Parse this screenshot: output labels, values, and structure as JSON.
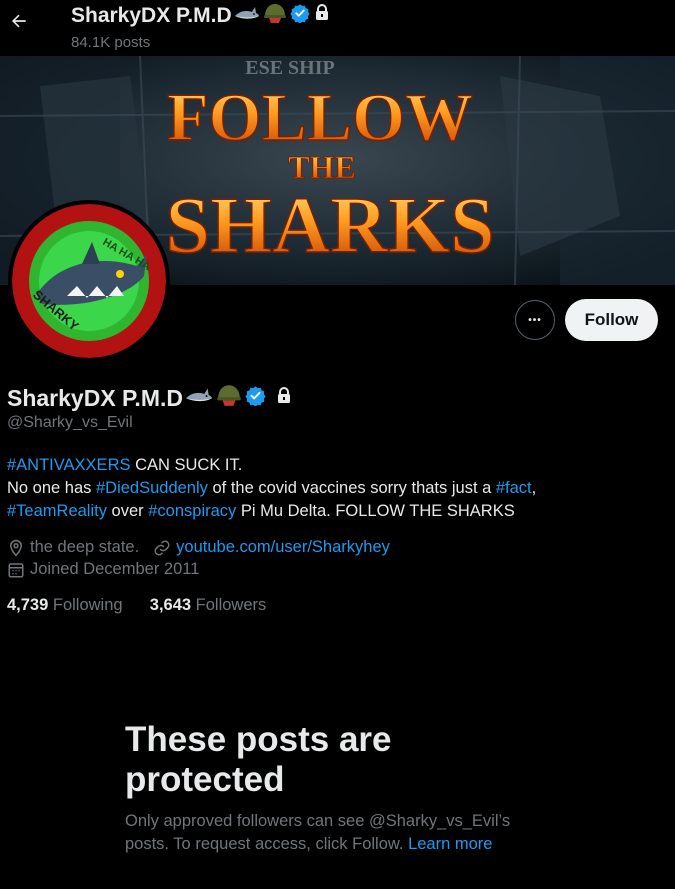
{
  "header": {
    "title": "SharkyDX P.M.D",
    "post_count": "84.1K posts"
  },
  "banner": {
    "line1": "FOLLOW",
    "line2": "THE",
    "line3": "SHARKS",
    "sign_text": "ESE SHIP"
  },
  "avatar": {
    "text_top": "HA HA HA",
    "text_bottom": "SHARKY"
  },
  "actions": {
    "more_label": "•••",
    "follow_label": "Follow"
  },
  "profile": {
    "name": "SharkyDX P.M.D",
    "handle": "@Sharky_vs_Evil",
    "bio": {
      "l1_tag": "#ANTIVAXXERS",
      "l1_text": " CAN SUCK IT.",
      "l2_a": "No one has ",
      "l2_tag": "#DiedSuddenly",
      "l2_b": " of the covid vaccines sorry thats just a ",
      "l2_tag2": "#fact",
      "l2_c": ",",
      "l3_tag": "#TeamReality",
      "l3_a": " over ",
      "l3_tag2": "#conspiracy",
      "l3_b": " Pi Mu Delta. FOLLOW THE SHARKS"
    },
    "location": "the deep state.",
    "website": "youtube.com/user/Sharkyhey",
    "joined": "Joined December 2011",
    "following_count": "4,739",
    "following_label": " Following",
    "followers_count": "3,643",
    "followers_label": " Followers"
  },
  "protected": {
    "title": "These posts are protected",
    "body": "Only approved followers can see @Sharky_vs_Evil’s posts. To request access, click Follow. ",
    "learn_more": "Learn more"
  },
  "colors": {
    "accent": "#1d9bf0",
    "secondary_text": "#71767b",
    "primary_text": "#e7e9ea",
    "background": "#000000"
  },
  "icons": [
    "back-arrow-icon",
    "shark-emoji-icon",
    "military-helmet-emoji-icon",
    "verified-badge-icon",
    "lock-icon",
    "location-pin-icon",
    "link-icon",
    "calendar-icon"
  ]
}
